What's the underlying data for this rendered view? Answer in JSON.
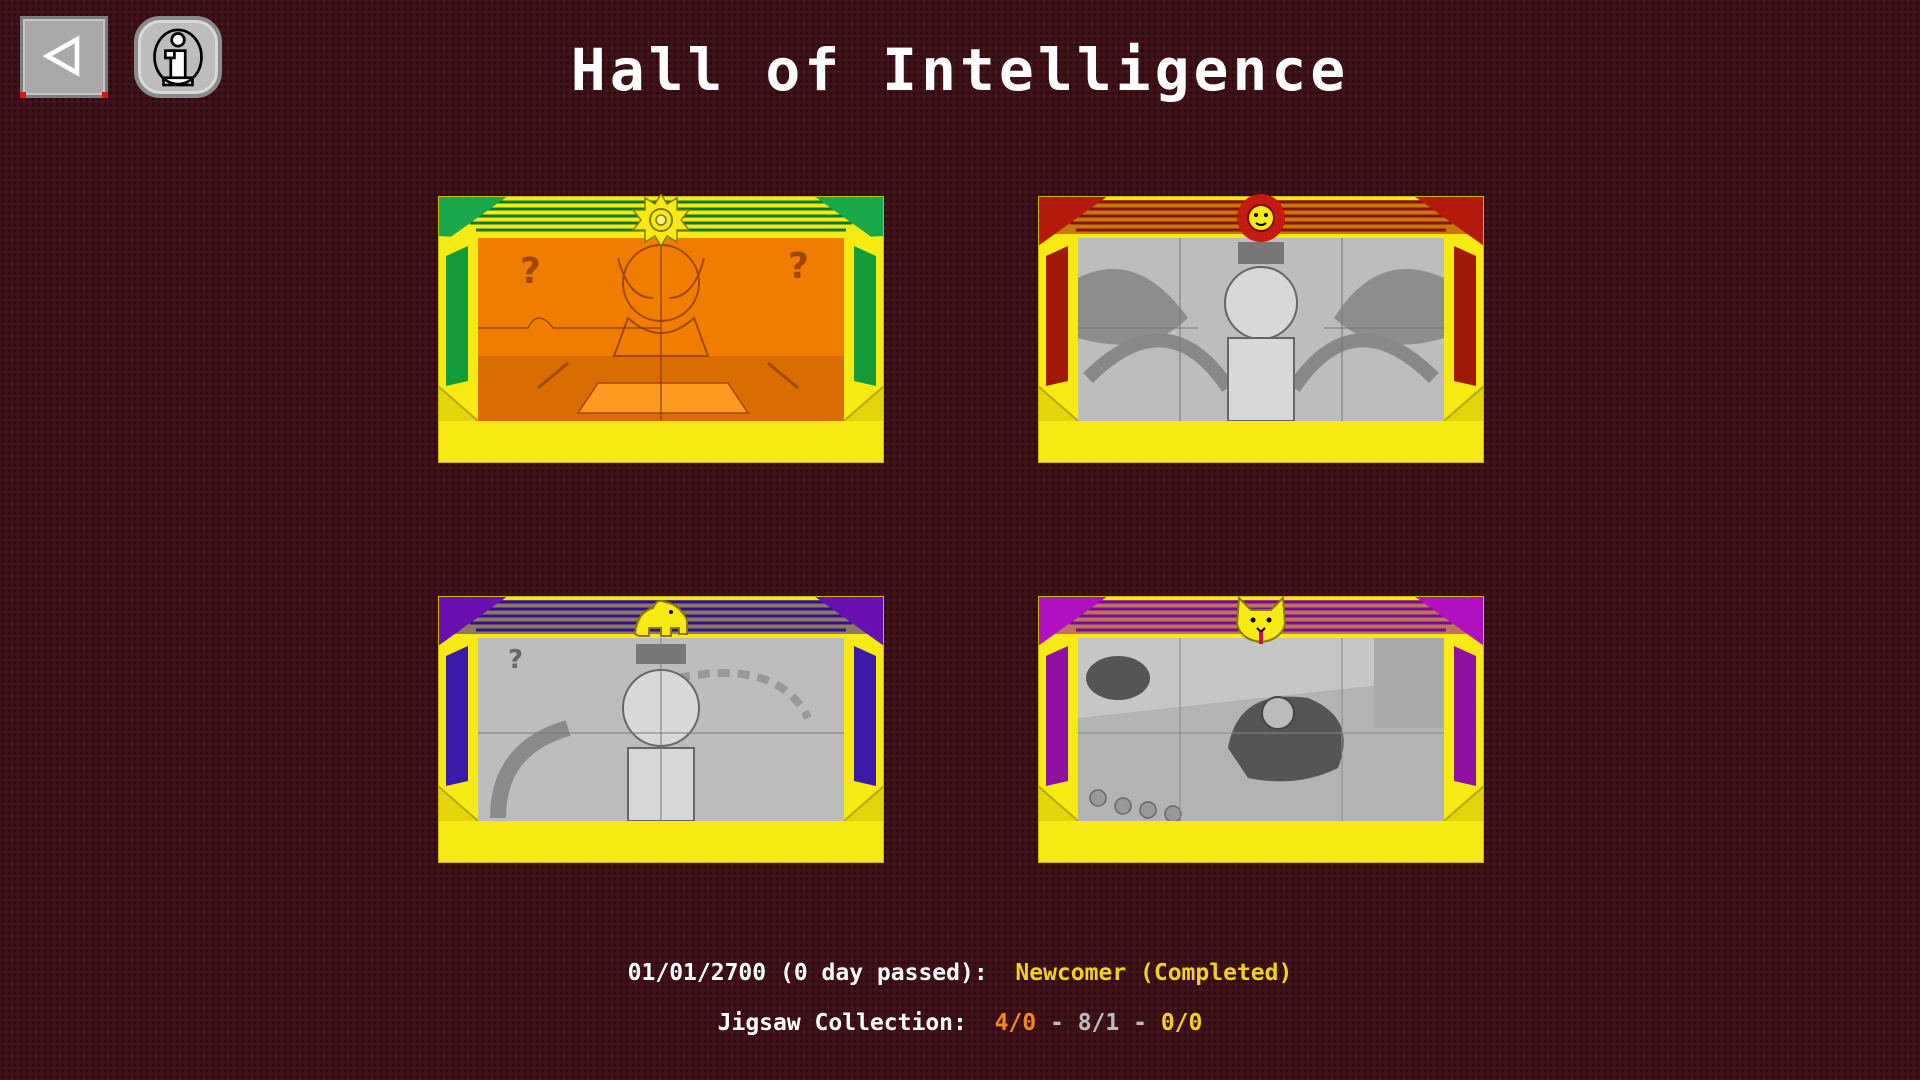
{
  "title": "Hall of Intelligence",
  "buttons": {
    "back_icon": "back-arrow-icon",
    "info_icon": "info-icon"
  },
  "frames": [
    {
      "theme": "green",
      "emblem": "sun-icon",
      "state": "completed",
      "colors": {
        "side": "#159c3a",
        "top_accent": "#19a84a",
        "puzzle_bg": "#f07d00"
      }
    },
    {
      "theme": "red",
      "emblem": "lion-icon",
      "state": "locked",
      "colors": {
        "side": "#a11a08",
        "top_accent": "#b41a0c",
        "puzzle_bg": "#b9b9b9"
      }
    },
    {
      "theme": "blue",
      "emblem": "bear-icon",
      "state": "locked",
      "colors": {
        "side": "#3a1aa8",
        "top_accent": "#4a10a8",
        "puzzle_bg": "#b9b9b9"
      }
    },
    {
      "theme": "purple",
      "emblem": "cat-icon",
      "state": "locked",
      "colors": {
        "side": "#8f10a3",
        "top_accent": "#a010b0",
        "puzzle_bg": "#b9b9b9"
      }
    }
  ],
  "footer": {
    "date_text": "01/01/2700 (0 day passed):",
    "status_text": "Newcomer (Completed)",
    "collection_label": "Jigsaw Collection:",
    "counts": [
      "4/0",
      "8/1",
      "0/0"
    ],
    "separator": "-"
  },
  "colors": {
    "frame_gold": "#f6ea12",
    "status_yellow": "#f2d21b",
    "count_orange": "#f28a1b",
    "count_grey": "#bdbdbd"
  }
}
